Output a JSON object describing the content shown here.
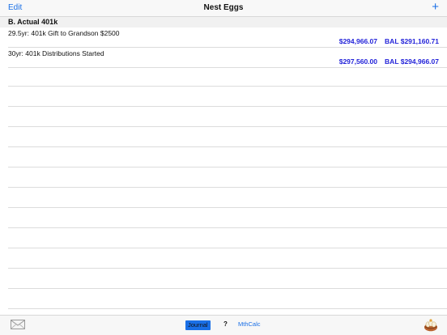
{
  "navbar": {
    "edit_label": "Edit",
    "title": "Nest Eggs",
    "add_label": "+"
  },
  "section": {
    "title": "B. Actual 401k"
  },
  "rows": [
    {
      "title": "29.5yr: 401k Gift to Grandson $2500",
      "amount": "$294,966.07",
      "balance": "BAL $291,160.71"
    },
    {
      "title": "30yr: 401k Distributions Started",
      "amount": "$297,560.00",
      "balance": "BAL $294,966.07"
    }
  ],
  "toolbar": {
    "mail_icon": "mail-icon",
    "journal_label": "Journal",
    "help_label": "?",
    "mthcalc_label": "MthCalc",
    "app_icon": "nest-egg-icon"
  },
  "colors": {
    "accent": "#1a6fe6",
    "value_blue": "#2323d9"
  }
}
